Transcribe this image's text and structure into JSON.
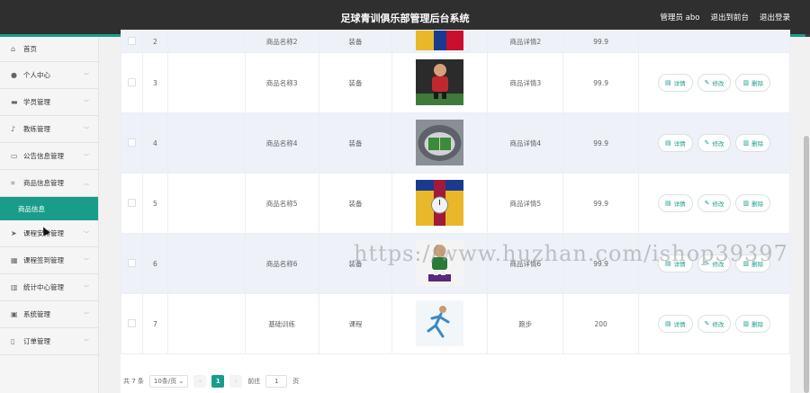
{
  "header": {
    "title": "足球青训俱乐部管理后台系统",
    "user": "管理员 abo",
    "to_front": "退出到前台",
    "logout": "退出登录"
  },
  "sidebar": {
    "items": [
      {
        "label": "首页",
        "icon": "home-icon"
      },
      {
        "label": "个人中心",
        "icon": "user-icon"
      },
      {
        "label": "学员管理",
        "icon": "students-icon"
      },
      {
        "label": "教练管理",
        "icon": "mic-icon"
      },
      {
        "label": "公告信息管理",
        "icon": "message-icon"
      },
      {
        "label": "商品信息管理",
        "icon": "crop-icon"
      }
    ],
    "active_sub": "商品信息",
    "items2": [
      {
        "label": "课程安排管理",
        "icon": "send-icon"
      },
      {
        "label": "课程签到管理",
        "icon": "calendar-icon"
      },
      {
        "label": "统计中心管理",
        "icon": "barcode-icon"
      },
      {
        "label": "系统管理",
        "icon": "window-icon"
      },
      {
        "label": "订单管理",
        "icon": "file-icon"
      }
    ]
  },
  "table": {
    "partial": {
      "index": "2",
      "name": "商品名称2",
      "category": "装备",
      "detail": "商品详情2",
      "price": "99.9"
    },
    "rows": [
      {
        "index": "3",
        "name": "商品名称3",
        "category": "装备",
        "detail": "商品详情3",
        "price": "99.9"
      },
      {
        "index": "4",
        "name": "商品名称4",
        "category": "装备",
        "detail": "商品详情4",
        "price": "99.9"
      },
      {
        "index": "5",
        "name": "商品名称5",
        "category": "装备",
        "detail": "商品详情5",
        "price": "99.9"
      },
      {
        "index": "6",
        "name": "商品名称6",
        "category": "装备",
        "detail": "商品详情6",
        "price": "99.9"
      },
      {
        "index": "7",
        "name": "基础训练",
        "category": "课程",
        "detail": "跑步",
        "price": "200"
      }
    ],
    "ops": {
      "detail": "详情",
      "edit": "修改",
      "delete": "删除"
    }
  },
  "pager": {
    "total": "共 7 条",
    "size": "10条/页",
    "current": "1",
    "goto": "前往",
    "goto_value": "1",
    "page_unit": "页"
  },
  "watermark": "https://www.huzhan.com/ishop39397",
  "colors": {
    "accent": "#1a9c8a",
    "header": "#2f2f2f"
  }
}
